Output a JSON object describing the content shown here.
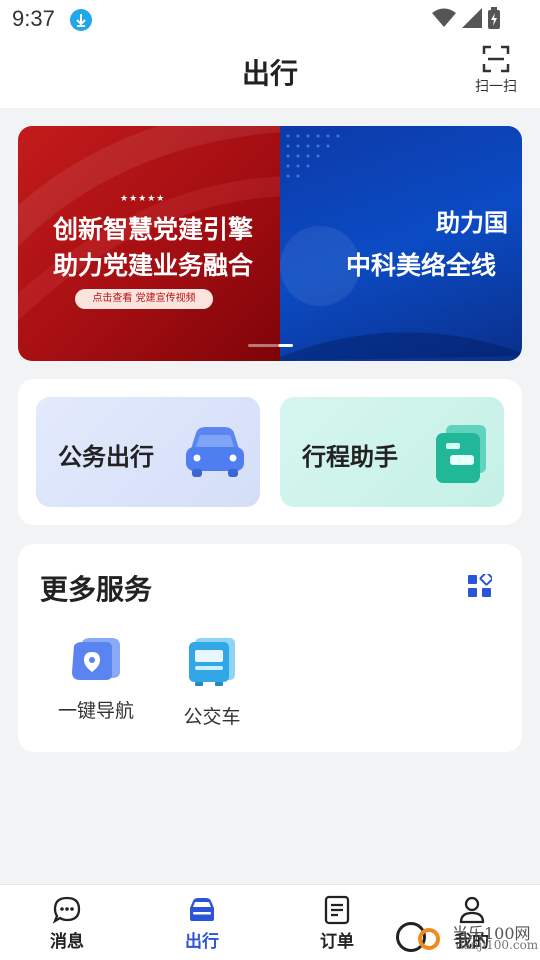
{
  "status_bar": {
    "time": "9:37",
    "icons": [
      "download-icon",
      "wifi-icon",
      "signal-icon",
      "battery-charging-icon"
    ]
  },
  "header": {
    "title": "出行",
    "scan_label": "扫一扫"
  },
  "banner": {
    "stars": "★★★★★",
    "left_line1": "创新智慧党建引擎",
    "left_line2": "助力党建业务融合",
    "left_pill": "点击查看  党建宣传视频",
    "right_line1": "助力国",
    "right_line2": "中科美络全线"
  },
  "quick_cards": [
    {
      "label": "公务出行",
      "icon": "car-icon",
      "color": "#4f7ef0"
    },
    {
      "label": "行程助手",
      "icon": "folder-icon",
      "color": "#21b89a"
    }
  ],
  "services": {
    "title": "更多服务",
    "items": [
      {
        "label": "一键导航",
        "icon": "map-pin-icon"
      },
      {
        "label": "公交车",
        "icon": "bus-icon"
      }
    ]
  },
  "bottom_nav": {
    "items": [
      {
        "label": "消息",
        "icon": "chat-icon",
        "active": false
      },
      {
        "label": "出行",
        "icon": "car-icon",
        "active": true
      },
      {
        "label": "订单",
        "icon": "document-icon",
        "active": false
      },
      {
        "label": "我的",
        "icon": "user-icon",
        "active": false
      }
    ],
    "active_color": "#2b54d9"
  },
  "watermark": {
    "text": "当乐100网",
    "sub": "danji100.com"
  }
}
